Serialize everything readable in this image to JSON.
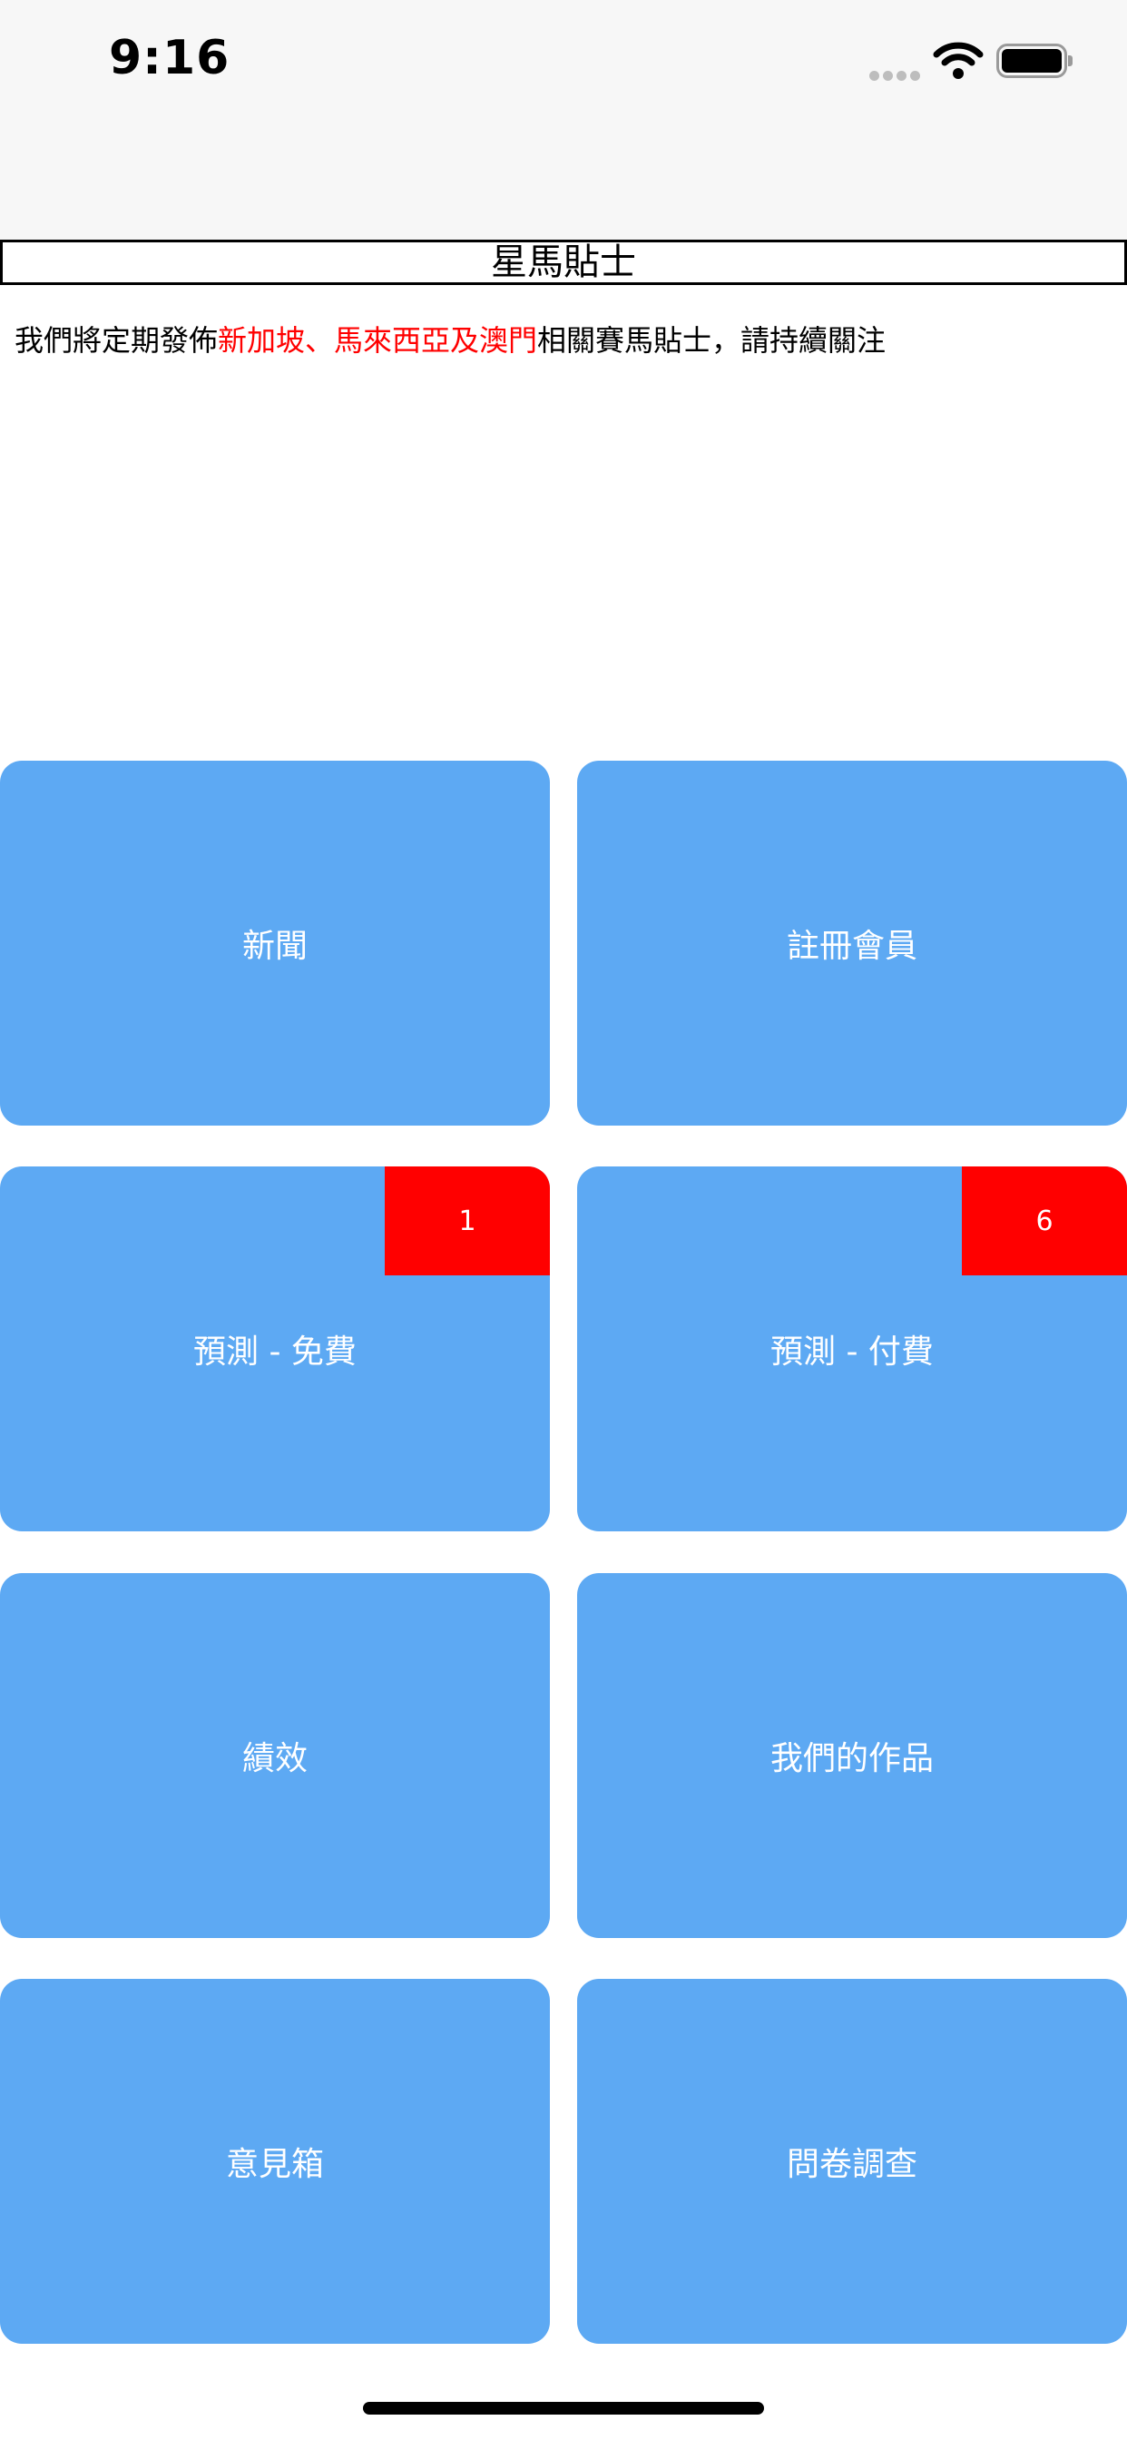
{
  "status_bar": {
    "time": "9:16",
    "signal_icon": "cellular-signal-icon",
    "wifi_icon": "wifi-icon",
    "battery_icon": "battery-icon"
  },
  "header": {
    "title": "星馬貼士"
  },
  "notice": {
    "prefix": "我們將定期發佈",
    "highlight": "新加坡、馬來西亞及澳門",
    "suffix": "相關賽馬貼士，請持續關注",
    "highlight_color": "#ff0000"
  },
  "menu": {
    "tile_color": "#5da9f3",
    "badge_color": "#ff0000",
    "items": [
      {
        "label": "新聞"
      },
      {
        "label": "註冊會員"
      },
      {
        "label": "預測 - 免費",
        "badge": "1"
      },
      {
        "label": "預測 - 付費",
        "badge": "6"
      },
      {
        "label": "績效"
      },
      {
        "label": "我們的作品"
      },
      {
        "label": "意見箱"
      },
      {
        "label": "問卷調查"
      }
    ]
  }
}
